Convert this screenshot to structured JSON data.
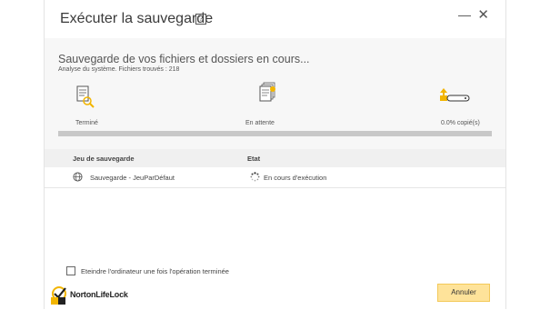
{
  "window": {
    "title": "Exécuter la sauvegarde",
    "help_glyph": "?",
    "minimize_glyph": "—",
    "close_glyph": "✕"
  },
  "status": {
    "title": "Sauvegarde de vos fichiers et dossiers en cours...",
    "subtitle": "Analyse du système. Fichiers trouvés : 218",
    "steps": [
      {
        "label": "Terminé",
        "icon": "document-magnifier-icon"
      },
      {
        "label": "En attente",
        "icon": "document-stack-icon"
      },
      {
        "label": "0.0% copié(s)",
        "icon": "upload-drive-icon"
      }
    ],
    "progress": 0
  },
  "table": {
    "headers": [
      "Jeu de sauvegarde",
      "Etat"
    ],
    "rows": [
      {
        "name": "Sauvegarde - JeuParDéfaut",
        "status": "En cours d'exécution",
        "icon": "globe-icon",
        "status_icon": "spinner-icon"
      }
    ]
  },
  "footer": {
    "shutdown_label": "Eteindre l'ordinateur une fois l'opération terminée",
    "shutdown_checked": false,
    "logo_text": "NortonLifeLock",
    "cancel_label": "Annuler"
  },
  "colors": {
    "accent": "#f2b500",
    "button_bg": "#fee39a",
    "panel_bg": "#f7f7f7"
  }
}
